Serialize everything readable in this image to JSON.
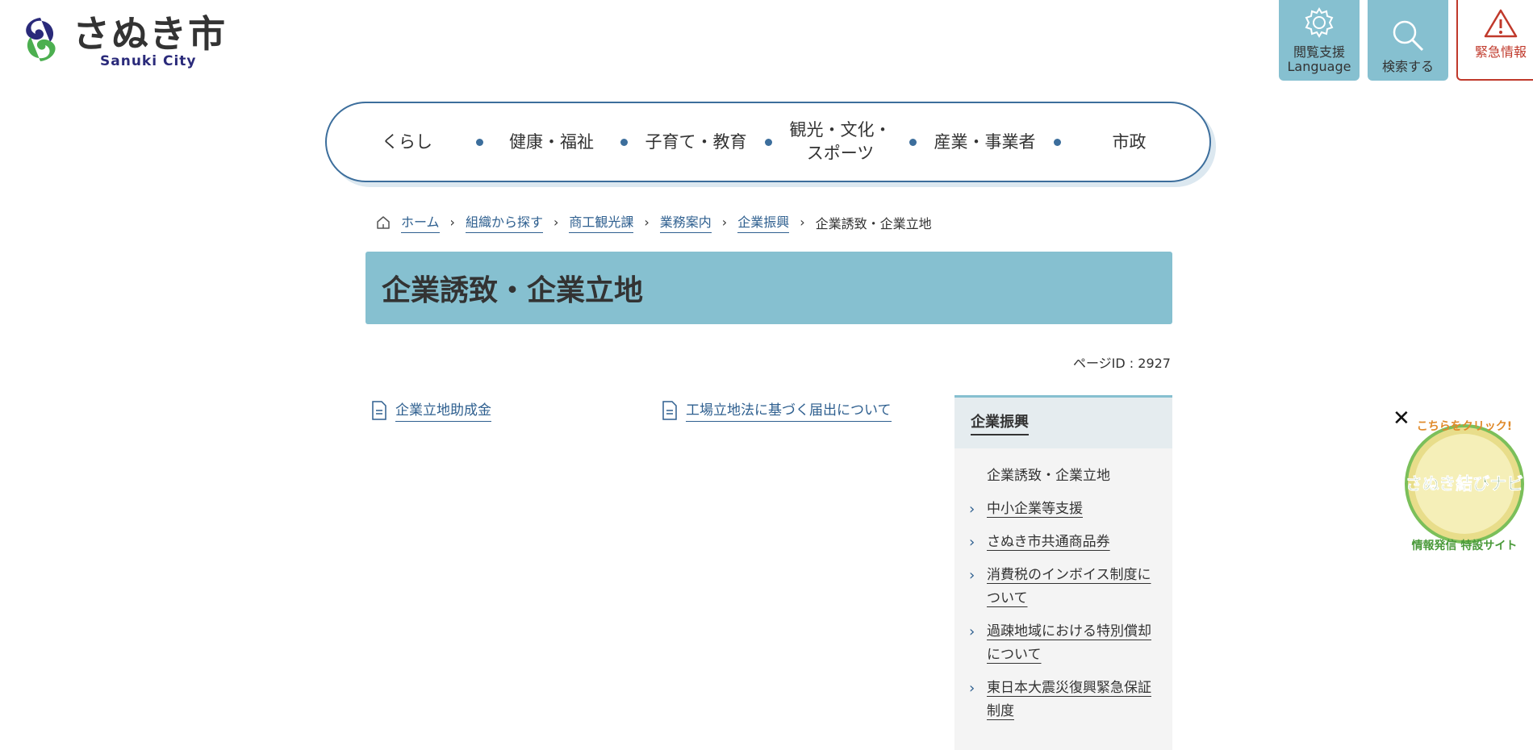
{
  "header": {
    "logo_jp": "さぬき市",
    "logo_en": "Sanuki City",
    "buttons": {
      "lang_line1": "閲覧支援",
      "lang_line2": "Language",
      "search": "検索する",
      "emergency": "緊急情報"
    }
  },
  "gnav": {
    "items": [
      "くらし",
      "健康・福祉",
      "子育て・教育",
      "観光・文化・",
      "スポーツ",
      "産業・事業者",
      "市政"
    ]
  },
  "breadcrumb": {
    "links": [
      "ホーム",
      "組織から探す",
      "商工観光課",
      "業務案内",
      "企業振興"
    ],
    "current": "企業誘致・企業立地"
  },
  "page": {
    "title": "企業誘致・企業立地",
    "page_id": "ページID : 2927",
    "links": [
      "企業立地助成金",
      "工場立地法に基づく届出について"
    ]
  },
  "side": {
    "heading": "企業振興",
    "items": [
      "企業誘致・企業立地",
      "中小企業等支援",
      "さぬき市共通商品券",
      "消費税のインボイス制度について",
      "過疎地域における特別償却について",
      "東日本大震災復興緊急保証制度"
    ]
  },
  "banner": {
    "top": "こちらをクリック!",
    "main": "さぬき結びナビ",
    "bottom": "情報発信 特設サイト",
    "close": "✕"
  },
  "colors": {
    "accent": "#86c0d0",
    "nav_border": "#3c6e9c",
    "link": "#2e5f8f",
    "emergency": "#c0392b"
  }
}
